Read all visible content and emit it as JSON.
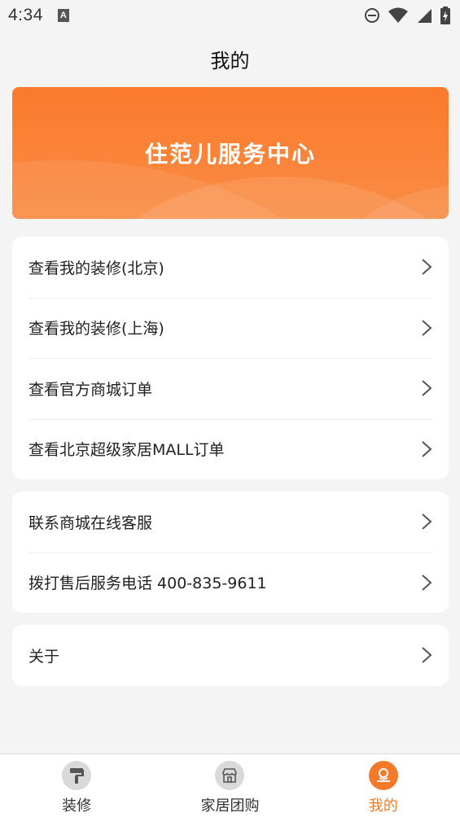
{
  "status_bar": {
    "time": "4:34",
    "notification_icon": "A",
    "icons": [
      "do-not-disturb-icon",
      "wifi-icon",
      "signal-icon",
      "battery-charging-icon"
    ]
  },
  "header": {
    "title": "我的"
  },
  "banner": {
    "title": "住范儿服务中心",
    "color": "#fb7a2c"
  },
  "orders_card": {
    "items": [
      {
        "label": "查看我的装修(北京)"
      },
      {
        "label": "查看我的装修(上海)"
      },
      {
        "label": "查看官方商城订单"
      },
      {
        "label": "查看北京超级家居MALL订单"
      }
    ]
  },
  "service_card": {
    "items": [
      {
        "label": "联系商城在线客服"
      },
      {
        "label": "拨打售后服务电话 400-835-9611"
      }
    ]
  },
  "about_card": {
    "items": [
      {
        "label": "关于"
      }
    ]
  },
  "bottom_nav": {
    "items": [
      {
        "label": "装修",
        "icon": "paint-roller-icon"
      },
      {
        "label": "家居团购",
        "icon": "shop-icon"
      },
      {
        "label": "我的",
        "icon": "user-icon",
        "active": true
      }
    ],
    "active_color": "#f47a2a"
  }
}
